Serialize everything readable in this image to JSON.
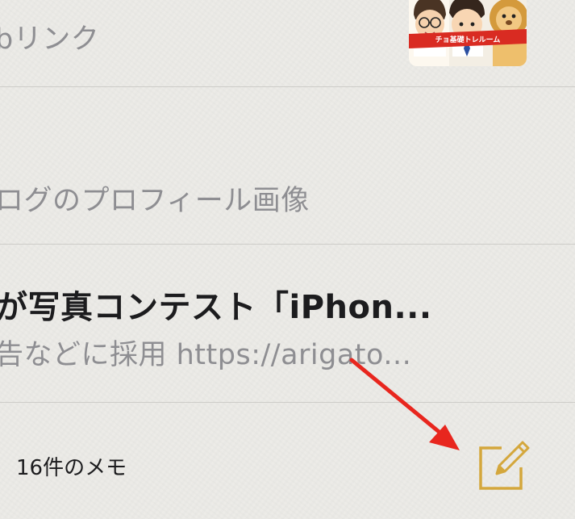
{
  "notes": [
    {
      "title": "",
      "subtitle": "bリンク",
      "thumbnail": {
        "banner_text": "チョ基礎トレルーム"
      }
    },
    {
      "title": "",
      "subtitle": "ログのプロフィール画像"
    },
    {
      "title": "が写真コンテスト「iPhon...",
      "subtitle": "告などに採用 https://arigato..."
    }
  ],
  "toolbar": {
    "count_label": "16件のメモ",
    "compose_icon": "compose-icon"
  },
  "colors": {
    "background": "#ecebe7",
    "title": "#1c1c1e",
    "subtitle": "#8e8e92",
    "accent": "#d4a73c",
    "annotation_arrow": "#e8261e"
  }
}
